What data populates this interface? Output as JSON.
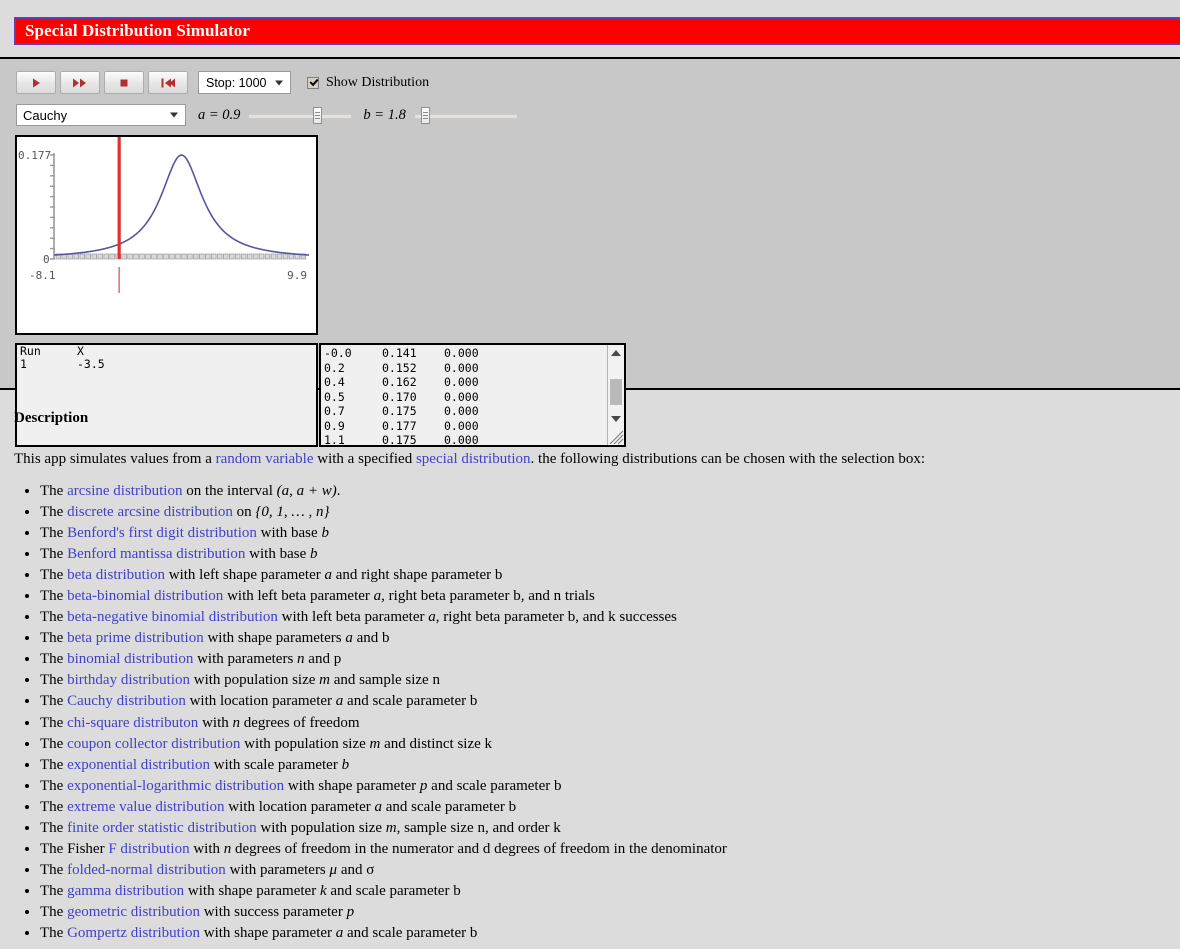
{
  "title": "Special Distribution Simulator",
  "toolbar": {
    "buttons": [
      {
        "name": "play",
        "glyph": "play-icon"
      },
      {
        "name": "fast-forward",
        "glyph": "fast-forward-icon"
      },
      {
        "name": "stop",
        "glyph": "stop-icon"
      },
      {
        "name": "reset",
        "glyph": "reset-icon"
      }
    ],
    "stop_select": {
      "label": "Stop: 1000",
      "value": "1000"
    },
    "show_distribution": {
      "label": "Show Distribution",
      "checked": true
    }
  },
  "params": {
    "distribution_select": {
      "value": "Cauchy"
    },
    "a": {
      "label": "a = 0.9",
      "name": "a",
      "value": "0.9",
      "thumb_pct": 62
    },
    "b": {
      "label": "b = 1.8",
      "name": "b",
      "value": "1.8",
      "thumb_pct": 6
    }
  },
  "chart_data": {
    "type": "line",
    "title": "",
    "xlabel": "",
    "ylabel": "",
    "xlim": [
      -8.1,
      9.9
    ],
    "ylim": [
      0,
      0.177
    ],
    "x_tick_labels": [
      "-8.1",
      "9.9"
    ],
    "y_tick_labels": [
      "0",
      "0.177"
    ],
    "y_tick_count": 11,
    "grid": false,
    "legend": "none",
    "marker_line_x": -3.5,
    "marker_color": "#e03030",
    "curve_color": "#5656a0",
    "series": [
      {
        "name": "Cauchy density (a = 0.9, b = 1.8)",
        "x": [
          -8.1,
          -7.2,
          -6.3,
          -5.4,
          -4.5,
          -3.6,
          -2.7,
          -1.8,
          -0.9,
          -0.0,
          0.9,
          1.8,
          2.7,
          3.6,
          4.5,
          5.4,
          6.3,
          7.2,
          8.1,
          9.0,
          9.9
        ],
        "y": [
          0.0064,
          0.0079,
          0.0101,
          0.0133,
          0.0183,
          0.0264,
          0.0405,
          0.0669,
          0.1139,
          0.1725,
          0.1768,
          0.1139,
          0.0669,
          0.0405,
          0.0264,
          0.0183,
          0.0133,
          0.0101,
          0.0079,
          0.0064,
          0.0053
        ]
      }
    ]
  },
  "run_table": {
    "headers": [
      "Run",
      "X"
    ],
    "rows": [
      [
        "1",
        "-3.5"
      ]
    ]
  },
  "dist_table": {
    "rows": [
      [
        "-0.0",
        "0.141",
        "0.000"
      ],
      [
        "0.2",
        "0.152",
        "0.000"
      ],
      [
        "0.4",
        "0.162",
        "0.000"
      ],
      [
        "0.5",
        "0.170",
        "0.000"
      ],
      [
        "0.7",
        "0.175",
        "0.000"
      ],
      [
        "0.9",
        "0.177",
        "0.000"
      ],
      [
        "1.1",
        "0.175",
        "0.000"
      ]
    ]
  },
  "description": {
    "heading": "Description",
    "intro": {
      "p1": "This app simulates values from a ",
      "link1": "random variable",
      "p2": " with a specified ",
      "link2": "special distribution",
      "p3": ". the following distributions can be chosen with the selection box:"
    },
    "items": [
      {
        "pre": "The ",
        "link": "arcsine distribution",
        "post": " on the interval ",
        "math": "(a, a + w)",
        "tail": "."
      },
      {
        "pre": "The ",
        "link": "discrete arcsine distribution",
        "post": " on ",
        "math": "{0, 1, … , n}",
        "tail": ""
      },
      {
        "pre": "The ",
        "link": "Benford's first digit distribution",
        "post": " with base ",
        "math": "b",
        "tail": ""
      },
      {
        "pre": "The ",
        "link": "Benford mantissa distribution",
        "post": " with base ",
        "math": "b",
        "tail": ""
      },
      {
        "pre": "The ",
        "link": "beta distribution",
        "post": " with left shape parameter ",
        "math": "a",
        "tail": " and right shape parameter b"
      },
      {
        "pre": "The ",
        "link": "beta-binomial distribution",
        "post": " with left beta parameter ",
        "math": "a",
        "tail": ", right beta parameter b, and n trials"
      },
      {
        "pre": "The ",
        "link": "beta-negative binomial distribution",
        "post": " with left beta parameter ",
        "math": "a",
        "tail": ", right beta parameter b, and k successes"
      },
      {
        "pre": "The ",
        "link": "beta prime distribution",
        "post": " with shape parameters ",
        "math": "a",
        "tail": " and b"
      },
      {
        "pre": "The ",
        "link": "binomial distribution",
        "post": " with parameters ",
        "math": "n",
        "tail": " and p"
      },
      {
        "pre": "The ",
        "link": "birthday distribution",
        "post": " with population size ",
        "math": "m",
        "tail": " and sample size n"
      },
      {
        "pre": "The ",
        "link": "Cauchy distribution",
        "post": " with location parameter ",
        "math": "a",
        "tail": " and scale parameter b"
      },
      {
        "pre": "The ",
        "link": "chi-square distributon",
        "post": " with ",
        "math": "n",
        "tail": " degrees of freedom"
      },
      {
        "pre": "The ",
        "link": "coupon collector distribution",
        "post": " with population size ",
        "math": "m",
        "tail": " and distinct size k"
      },
      {
        "pre": "The ",
        "link": "exponential distribution",
        "post": " with scale parameter ",
        "math": "b",
        "tail": ""
      },
      {
        "pre": "The ",
        "link": "exponential-logarithmic distribution",
        "post": " with shape parameter ",
        "math": "p",
        "tail": " and scale parameter b"
      },
      {
        "pre": "The ",
        "link": "extreme value distribution",
        "post": " with location parameter ",
        "math": "a",
        "tail": " and scale parameter b"
      },
      {
        "pre": "The ",
        "link": "finite order statistic distribution",
        "post": " with population size ",
        "math": "m",
        "tail": ", sample size n, and order k"
      },
      {
        "pre": "The Fisher ",
        "link": "F distribution",
        "post": " with ",
        "math": "n",
        "tail": " degrees of freedom in the numerator and d degrees of freedom in the denominator"
      },
      {
        "pre": "The ",
        "link": "folded-normal distribution",
        "post": " with parameters ",
        "math": "μ",
        "tail": " and σ"
      },
      {
        "pre": "The ",
        "link": "gamma distribution",
        "post": " with shape parameter ",
        "math": "k",
        "tail": " and scale parameter b"
      },
      {
        "pre": "The ",
        "link": "geometric distribution",
        "post": " with success parameter ",
        "math": "p",
        "tail": ""
      },
      {
        "pre": "The ",
        "link": "Gompertz distribution",
        "post": " with shape parameter ",
        "math": "a",
        "tail": " and scale parameter b"
      }
    ]
  },
  "colors": {
    "title_bar": "#fe0000",
    "title_border": "#6a3ab2",
    "page_bg": "#dcdcdc",
    "applet_bg": "#c8c8c8",
    "link": "#4141c8"
  }
}
